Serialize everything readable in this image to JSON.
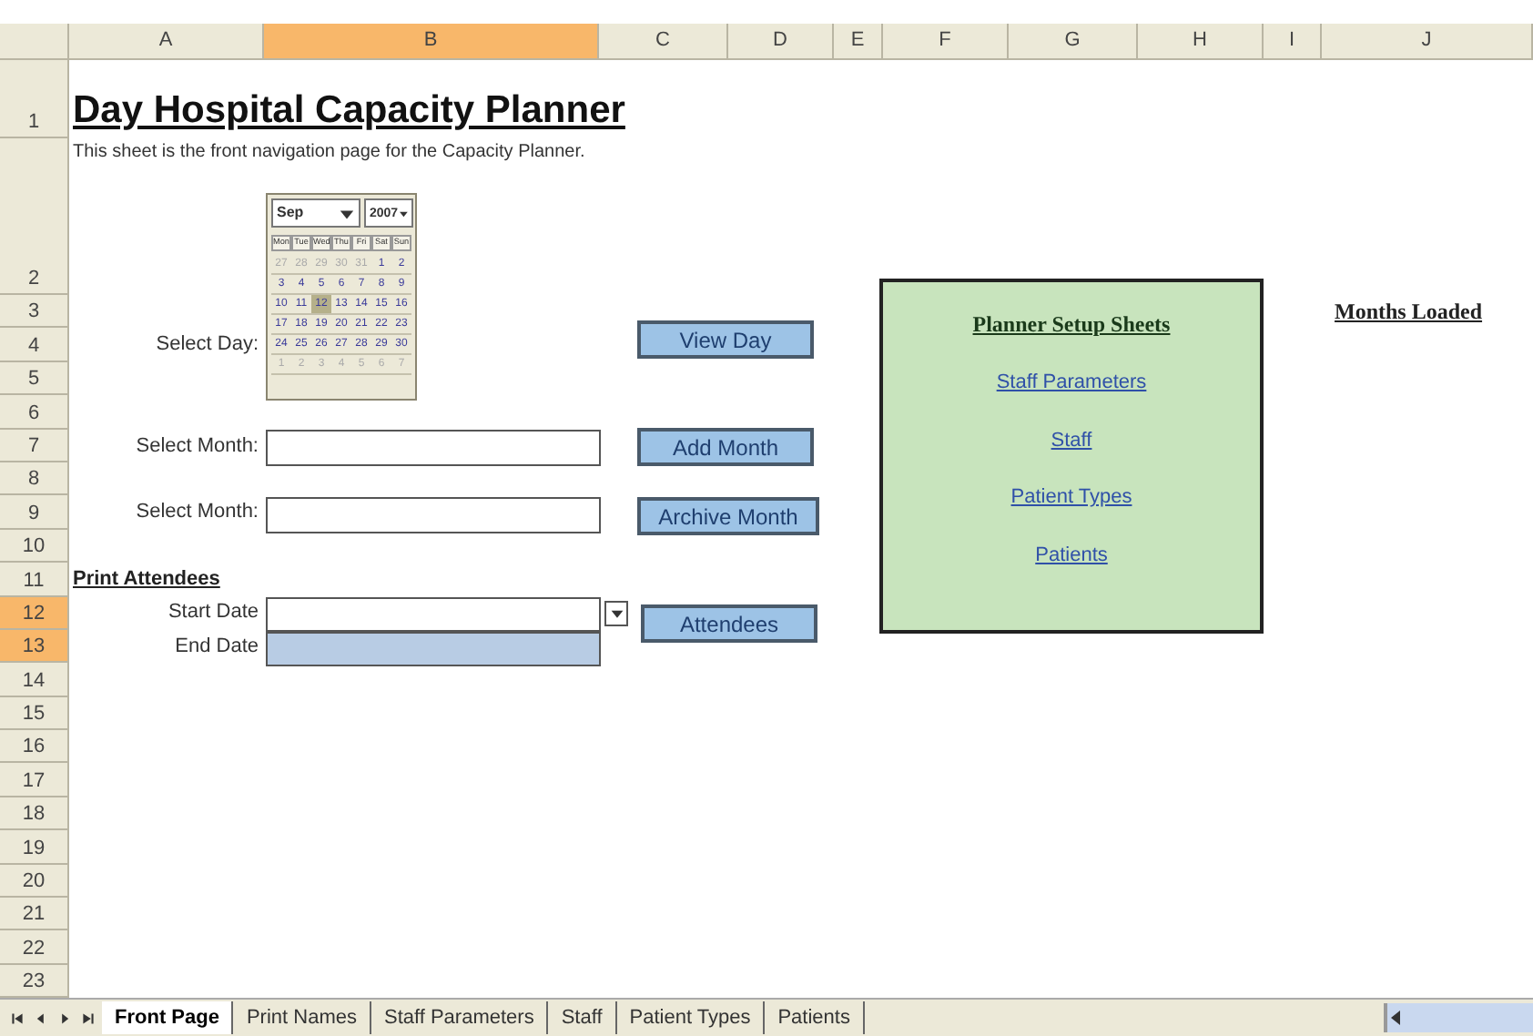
{
  "columns": [
    {
      "label": "A",
      "selected": false
    },
    {
      "label": "B",
      "selected": true
    },
    {
      "label": "C",
      "selected": false
    },
    {
      "label": "D",
      "selected": false
    },
    {
      "label": "E",
      "selected": false
    },
    {
      "label": "F",
      "selected": false
    },
    {
      "label": "G",
      "selected": false
    },
    {
      "label": "H",
      "selected": false
    },
    {
      "label": "I",
      "selected": false
    },
    {
      "label": "J",
      "selected": false
    }
  ],
  "rows": [
    {
      "label": "1",
      "selected": false
    },
    {
      "label": "2",
      "selected": false
    },
    {
      "label": "3",
      "selected": false
    },
    {
      "label": "4",
      "selected": false
    },
    {
      "label": "5",
      "selected": false
    },
    {
      "label": "6",
      "selected": false
    },
    {
      "label": "7",
      "selected": false
    },
    {
      "label": "8",
      "selected": false
    },
    {
      "label": "9",
      "selected": false
    },
    {
      "label": "10",
      "selected": false
    },
    {
      "label": "11",
      "selected": false
    },
    {
      "label": "12",
      "selected": true
    },
    {
      "label": "13",
      "selected": true
    },
    {
      "label": "14",
      "selected": false
    },
    {
      "label": "15",
      "selected": false
    },
    {
      "label": "16",
      "selected": false
    },
    {
      "label": "17",
      "selected": false
    },
    {
      "label": "18",
      "selected": false
    },
    {
      "label": "19",
      "selected": false
    },
    {
      "label": "20",
      "selected": false
    },
    {
      "label": "21",
      "selected": false
    },
    {
      "label": "22",
      "selected": false
    },
    {
      "label": "23",
      "selected": false
    }
  ],
  "title": "Day Hospital Capacity Planner",
  "subtitle": "This sheet is the front navigation page for the Capacity Planner.",
  "select_day": {
    "label": "Select Day:",
    "button": "View Day",
    "calendar": {
      "month": "Sep",
      "year": "2007",
      "weekdays": [
        "Mon",
        "Tue",
        "Wed",
        "Thu",
        "Fri",
        "Sat",
        "Sun"
      ],
      "days": [
        {
          "label": "27",
          "muted": true,
          "selected": false
        },
        {
          "label": "28",
          "muted": true,
          "selected": false
        },
        {
          "label": "29",
          "muted": true,
          "selected": false
        },
        {
          "label": "30",
          "muted": true,
          "selected": false
        },
        {
          "label": "31",
          "muted": true,
          "selected": false
        },
        {
          "label": "1",
          "muted": false,
          "selected": false
        },
        {
          "label": "2",
          "muted": false,
          "selected": false
        },
        {
          "label": "3",
          "muted": false,
          "selected": false
        },
        {
          "label": "4",
          "muted": false,
          "selected": false
        },
        {
          "label": "5",
          "muted": false,
          "selected": false
        },
        {
          "label": "6",
          "muted": false,
          "selected": false
        },
        {
          "label": "7",
          "muted": false,
          "selected": false
        },
        {
          "label": "8",
          "muted": false,
          "selected": false
        },
        {
          "label": "9",
          "muted": false,
          "selected": false
        },
        {
          "label": "10",
          "muted": false,
          "selected": false
        },
        {
          "label": "11",
          "muted": false,
          "selected": false
        },
        {
          "label": "12",
          "muted": false,
          "selected": true
        },
        {
          "label": "13",
          "muted": false,
          "selected": false
        },
        {
          "label": "14",
          "muted": false,
          "selected": false
        },
        {
          "label": "15",
          "muted": false,
          "selected": false
        },
        {
          "label": "16",
          "muted": false,
          "selected": false
        },
        {
          "label": "17",
          "muted": false,
          "selected": false
        },
        {
          "label": "18",
          "muted": false,
          "selected": false
        },
        {
          "label": "19",
          "muted": false,
          "selected": false
        },
        {
          "label": "20",
          "muted": false,
          "selected": false
        },
        {
          "label": "21",
          "muted": false,
          "selected": false
        },
        {
          "label": "22",
          "muted": false,
          "selected": false
        },
        {
          "label": "23",
          "muted": false,
          "selected": false
        },
        {
          "label": "24",
          "muted": false,
          "selected": false
        },
        {
          "label": "25",
          "muted": false,
          "selected": false
        },
        {
          "label": "26",
          "muted": false,
          "selected": false
        },
        {
          "label": "27",
          "muted": false,
          "selected": false
        },
        {
          "label": "28",
          "muted": false,
          "selected": false
        },
        {
          "label": "29",
          "muted": false,
          "selected": false
        },
        {
          "label": "30",
          "muted": false,
          "selected": false
        },
        {
          "label": "1",
          "muted": true,
          "selected": false
        },
        {
          "label": "2",
          "muted": true,
          "selected": false
        },
        {
          "label": "3",
          "muted": true,
          "selected": false
        },
        {
          "label": "4",
          "muted": true,
          "selected": false
        },
        {
          "label": "5",
          "muted": true,
          "selected": false
        },
        {
          "label": "6",
          "muted": true,
          "selected": false
        },
        {
          "label": "7",
          "muted": true,
          "selected": false
        }
      ]
    }
  },
  "month_rows": [
    {
      "label": "Select Month:",
      "button": "Add Month"
    },
    {
      "label": "Select Month:",
      "button": "Archive Month"
    }
  ],
  "print_attendees": {
    "heading": "Print Attendees",
    "button": "Attendees",
    "fields": [
      {
        "label": "Start Date",
        "dropdown": true,
        "selected": false
      },
      {
        "label": "End Date",
        "dropdown": false,
        "selected": true
      }
    ]
  },
  "setup_box": {
    "heading": "Planner Setup Sheets",
    "links": [
      "Staff Parameters",
      "Staff",
      "Patient Types",
      "Patients"
    ]
  },
  "months_loaded": "Months Loaded",
  "sheet_tabs": [
    {
      "label": "Front Page",
      "selected": true
    },
    {
      "label": "Print Names",
      "selected": false
    },
    {
      "label": "Staff Parameters",
      "selected": false
    },
    {
      "label": "Staff",
      "selected": false
    },
    {
      "label": "Patient Types",
      "selected": false
    },
    {
      "label": "Patients",
      "selected": false
    }
  ]
}
